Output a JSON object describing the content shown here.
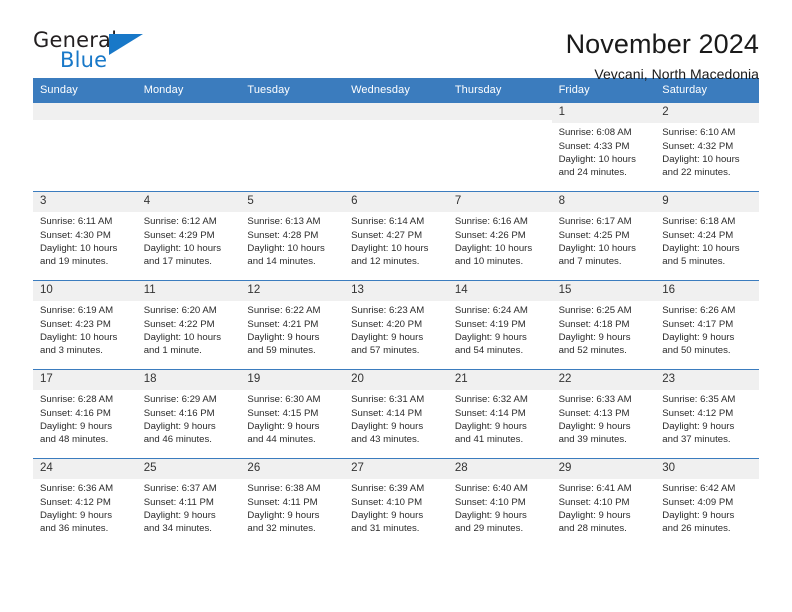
{
  "brand": {
    "word1": "General",
    "word2": "Blue",
    "accent_color": "#1878c8",
    "triangle_icon": "triangle-icon"
  },
  "header": {
    "title": "November 2024",
    "subtitle": "Vevcani, North Macedonia",
    "header_bg_color": "#3b7cbe",
    "daynum_bg_color": "#f0f0f0"
  },
  "calendar": {
    "weekdays": [
      "Sunday",
      "Monday",
      "Tuesday",
      "Wednesday",
      "Thursday",
      "Friday",
      "Saturday"
    ],
    "weeks": [
      [
        {
          "day": "",
          "empty": true
        },
        {
          "day": "",
          "empty": true
        },
        {
          "day": "",
          "empty": true
        },
        {
          "day": "",
          "empty": true
        },
        {
          "day": "",
          "empty": true
        },
        {
          "day": "1",
          "sunrise": "Sunrise: 6:08 AM",
          "sunset": "Sunset: 4:33 PM",
          "daylight1": "Daylight: 10 hours",
          "daylight2": "and 24 minutes."
        },
        {
          "day": "2",
          "sunrise": "Sunrise: 6:10 AM",
          "sunset": "Sunset: 4:32 PM",
          "daylight1": "Daylight: 10 hours",
          "daylight2": "and 22 minutes."
        }
      ],
      [
        {
          "day": "3",
          "sunrise": "Sunrise: 6:11 AM",
          "sunset": "Sunset: 4:30 PM",
          "daylight1": "Daylight: 10 hours",
          "daylight2": "and 19 minutes."
        },
        {
          "day": "4",
          "sunrise": "Sunrise: 6:12 AM",
          "sunset": "Sunset: 4:29 PM",
          "daylight1": "Daylight: 10 hours",
          "daylight2": "and 17 minutes."
        },
        {
          "day": "5",
          "sunrise": "Sunrise: 6:13 AM",
          "sunset": "Sunset: 4:28 PM",
          "daylight1": "Daylight: 10 hours",
          "daylight2": "and 14 minutes."
        },
        {
          "day": "6",
          "sunrise": "Sunrise: 6:14 AM",
          "sunset": "Sunset: 4:27 PM",
          "daylight1": "Daylight: 10 hours",
          "daylight2": "and 12 minutes."
        },
        {
          "day": "7",
          "sunrise": "Sunrise: 6:16 AM",
          "sunset": "Sunset: 4:26 PM",
          "daylight1": "Daylight: 10 hours",
          "daylight2": "and 10 minutes."
        },
        {
          "day": "8",
          "sunrise": "Sunrise: 6:17 AM",
          "sunset": "Sunset: 4:25 PM",
          "daylight1": "Daylight: 10 hours",
          "daylight2": "and 7 minutes."
        },
        {
          "day": "9",
          "sunrise": "Sunrise: 6:18 AM",
          "sunset": "Sunset: 4:24 PM",
          "daylight1": "Daylight: 10 hours",
          "daylight2": "and 5 minutes."
        }
      ],
      [
        {
          "day": "10",
          "sunrise": "Sunrise: 6:19 AM",
          "sunset": "Sunset: 4:23 PM",
          "daylight1": "Daylight: 10 hours",
          "daylight2": "and 3 minutes."
        },
        {
          "day": "11",
          "sunrise": "Sunrise: 6:20 AM",
          "sunset": "Sunset: 4:22 PM",
          "daylight1": "Daylight: 10 hours",
          "daylight2": "and 1 minute."
        },
        {
          "day": "12",
          "sunrise": "Sunrise: 6:22 AM",
          "sunset": "Sunset: 4:21 PM",
          "daylight1": "Daylight: 9 hours",
          "daylight2": "and 59 minutes."
        },
        {
          "day": "13",
          "sunrise": "Sunrise: 6:23 AM",
          "sunset": "Sunset: 4:20 PM",
          "daylight1": "Daylight: 9 hours",
          "daylight2": "and 57 minutes."
        },
        {
          "day": "14",
          "sunrise": "Sunrise: 6:24 AM",
          "sunset": "Sunset: 4:19 PM",
          "daylight1": "Daylight: 9 hours",
          "daylight2": "and 54 minutes."
        },
        {
          "day": "15",
          "sunrise": "Sunrise: 6:25 AM",
          "sunset": "Sunset: 4:18 PM",
          "daylight1": "Daylight: 9 hours",
          "daylight2": "and 52 minutes."
        },
        {
          "day": "16",
          "sunrise": "Sunrise: 6:26 AM",
          "sunset": "Sunset: 4:17 PM",
          "daylight1": "Daylight: 9 hours",
          "daylight2": "and 50 minutes."
        }
      ],
      [
        {
          "day": "17",
          "sunrise": "Sunrise: 6:28 AM",
          "sunset": "Sunset: 4:16 PM",
          "daylight1": "Daylight: 9 hours",
          "daylight2": "and 48 minutes."
        },
        {
          "day": "18",
          "sunrise": "Sunrise: 6:29 AM",
          "sunset": "Sunset: 4:16 PM",
          "daylight1": "Daylight: 9 hours",
          "daylight2": "and 46 minutes."
        },
        {
          "day": "19",
          "sunrise": "Sunrise: 6:30 AM",
          "sunset": "Sunset: 4:15 PM",
          "daylight1": "Daylight: 9 hours",
          "daylight2": "and 44 minutes."
        },
        {
          "day": "20",
          "sunrise": "Sunrise: 6:31 AM",
          "sunset": "Sunset: 4:14 PM",
          "daylight1": "Daylight: 9 hours",
          "daylight2": "and 43 minutes."
        },
        {
          "day": "21",
          "sunrise": "Sunrise: 6:32 AM",
          "sunset": "Sunset: 4:14 PM",
          "daylight1": "Daylight: 9 hours",
          "daylight2": "and 41 minutes."
        },
        {
          "day": "22",
          "sunrise": "Sunrise: 6:33 AM",
          "sunset": "Sunset: 4:13 PM",
          "daylight1": "Daylight: 9 hours",
          "daylight2": "and 39 minutes."
        },
        {
          "day": "23",
          "sunrise": "Sunrise: 6:35 AM",
          "sunset": "Sunset: 4:12 PM",
          "daylight1": "Daylight: 9 hours",
          "daylight2": "and 37 minutes."
        }
      ],
      [
        {
          "day": "24",
          "sunrise": "Sunrise: 6:36 AM",
          "sunset": "Sunset: 4:12 PM",
          "daylight1": "Daylight: 9 hours",
          "daylight2": "and 36 minutes."
        },
        {
          "day": "25",
          "sunrise": "Sunrise: 6:37 AM",
          "sunset": "Sunset: 4:11 PM",
          "daylight1": "Daylight: 9 hours",
          "daylight2": "and 34 minutes."
        },
        {
          "day": "26",
          "sunrise": "Sunrise: 6:38 AM",
          "sunset": "Sunset: 4:11 PM",
          "daylight1": "Daylight: 9 hours",
          "daylight2": "and 32 minutes."
        },
        {
          "day": "27",
          "sunrise": "Sunrise: 6:39 AM",
          "sunset": "Sunset: 4:10 PM",
          "daylight1": "Daylight: 9 hours",
          "daylight2": "and 31 minutes."
        },
        {
          "day": "28",
          "sunrise": "Sunrise: 6:40 AM",
          "sunset": "Sunset: 4:10 PM",
          "daylight1": "Daylight: 9 hours",
          "daylight2": "and 29 minutes."
        },
        {
          "day": "29",
          "sunrise": "Sunrise: 6:41 AM",
          "sunset": "Sunset: 4:10 PM",
          "daylight1": "Daylight: 9 hours",
          "daylight2": "and 28 minutes."
        },
        {
          "day": "30",
          "sunrise": "Sunrise: 6:42 AM",
          "sunset": "Sunset: 4:09 PM",
          "daylight1": "Daylight: 9 hours",
          "daylight2": "and 26 minutes."
        }
      ]
    ]
  }
}
